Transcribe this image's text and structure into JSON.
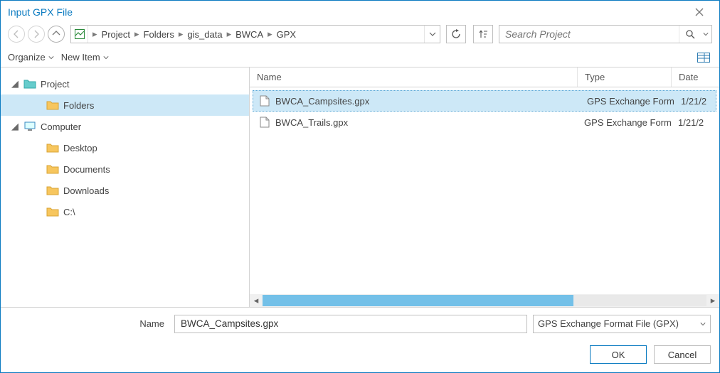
{
  "title": "Input GPX File",
  "breadcrumbs": [
    "Project",
    "Folders",
    "gis_data",
    "BWCA",
    "GPX"
  ],
  "search": {
    "placeholder": "Search Project"
  },
  "toolbar": {
    "organize": "Organize",
    "newitem": "New Item"
  },
  "sidebar": {
    "project": {
      "label": "Project",
      "expanded": true
    },
    "folders": {
      "label": "Folders",
      "selected": true
    },
    "computer": {
      "label": "Computer",
      "expanded": true
    },
    "desktop": {
      "label": "Desktop"
    },
    "documents": {
      "label": "Documents"
    },
    "downloads": {
      "label": "Downloads"
    },
    "cdrive": {
      "label": "C:\\"
    }
  },
  "columns": {
    "name": "Name",
    "type": "Type",
    "date": "Date"
  },
  "files": [
    {
      "name": "BWCA_Campsites.gpx",
      "type": "GPS Exchange Form",
      "date": "1/21/2",
      "selected": true
    },
    {
      "name": "BWCA_Trails.gpx",
      "type": "GPS Exchange Form",
      "date": "1/21/2",
      "selected": false
    }
  ],
  "footer": {
    "name_label": "Name",
    "name_value": "BWCA_Campsites.gpx",
    "filter_label": "GPS Exchange Format File (GPX)"
  },
  "buttons": {
    "ok": "OK",
    "cancel": "Cancel"
  }
}
